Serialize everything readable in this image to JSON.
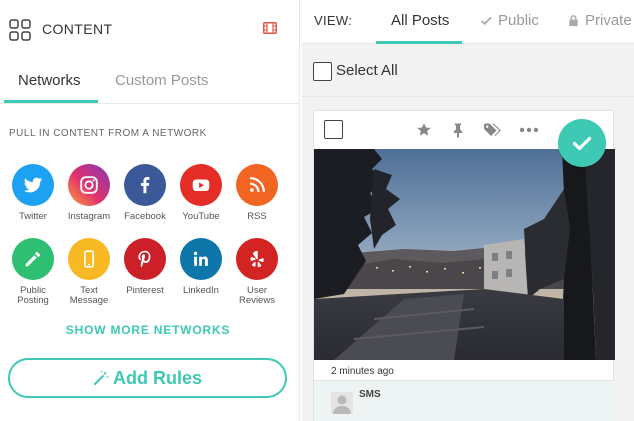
{
  "left_panel": {
    "header_title": "CONTENT",
    "tabs": [
      {
        "label": "Networks",
        "active": true
      },
      {
        "label": "Custom Posts",
        "active": false
      }
    ],
    "pull_label": "PULL IN CONTENT FROM A NETWORK",
    "networks": [
      {
        "label": "Twitter",
        "icon": "twitter-icon",
        "color": "#1da1f2"
      },
      {
        "label": "Instagram",
        "icon": "instagram-icon",
        "color": "#c13584"
      },
      {
        "label": "Facebook",
        "icon": "facebook-icon",
        "color": "#3b5998"
      },
      {
        "label": "YouTube",
        "icon": "youtube-icon",
        "color": "#e52d27"
      },
      {
        "label": "RSS",
        "icon": "rss-icon",
        "color": "#f26522"
      },
      {
        "label": "Public Posting",
        "label_lines": [
          "Public",
          "Posting"
        ],
        "icon": "pencil-icon",
        "color": "#2ebf72"
      },
      {
        "label": "Text Message",
        "label_lines": [
          "Text",
          "Message"
        ],
        "icon": "phone-icon",
        "color": "#f7b924"
      },
      {
        "label": "Pinterest",
        "icon": "pinterest-icon",
        "color": "#cb2027"
      },
      {
        "label": "LinkedIn",
        "icon": "linkedin-icon",
        "color": "#0e76a8"
      },
      {
        "label": "User Reviews",
        "label_lines": [
          "User",
          "Reviews"
        ],
        "icon": "yelp-icon",
        "color": "#d32323"
      }
    ],
    "show_more": "SHOW MORE NETWORKS",
    "add_rules": "Add Rules"
  },
  "right_panel": {
    "view_label": "VIEW:",
    "view_tabs": [
      {
        "label": "All Posts",
        "active": true
      },
      {
        "label": "Public",
        "active": false,
        "icon": "check-icon"
      },
      {
        "label": "Private",
        "active": false,
        "icon": "lock-icon"
      }
    ],
    "select_all": "Select All",
    "post": {
      "time": "2 minutes ago",
      "author": "SMS",
      "approved": true,
      "actions": [
        "star-icon",
        "pin-icon",
        "tags-icon",
        "more-icon"
      ]
    }
  },
  "colors": {
    "accent": "#3dc9b3",
    "film_icon": "#e05a4e"
  }
}
